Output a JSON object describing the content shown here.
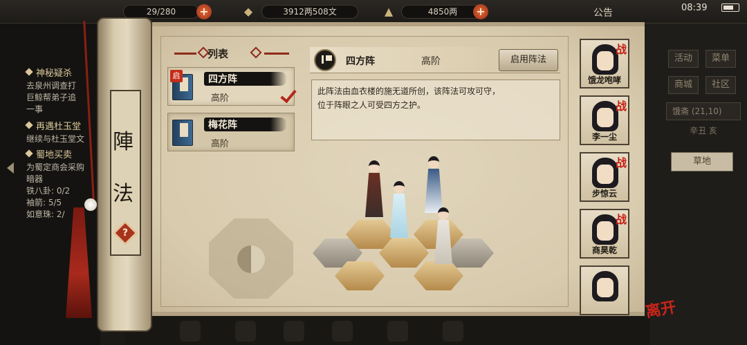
{
  "status_bar": {
    "resource1": "29/280",
    "resource2": "3912两508文",
    "resource3": "4850两",
    "announcement": "公告",
    "clock": "08:39"
  },
  "quest_panel": {
    "quests": [
      {
        "title": "神秘疑杀",
        "lines": [
          "去泉州调查打",
          "巨鲸帮弟子追",
          "一事"
        ]
      },
      {
        "title": "再遇杜玉堂",
        "lines": [
          "继续与杜玉堂文"
        ]
      },
      {
        "title": "蜀地买卖",
        "lines": [
          "为蜀定商会采购",
          "暗器",
          "铁八卦: 0/2",
          "袖箭: 5/5",
          "如意珠: 2/"
        ]
      }
    ]
  },
  "scroll": {
    "chars": [
      "陣",
      "法"
    ],
    "help": "?"
  },
  "list": {
    "title": "列表",
    "items": [
      {
        "name": "四方阵",
        "tier": "高阶",
        "tag": "启",
        "selected": true
      },
      {
        "name": "梅花阵",
        "tier": "高阶",
        "tag": "",
        "selected": false
      }
    ]
  },
  "detail": {
    "name": "四方阵",
    "tier": "高阶",
    "activate_label": "启用阵法",
    "description": [
      "此阵法由血衣楼的施无道所创，该阵法可攻可守，",
      "位于阵眼之人可受四方之护。"
    ]
  },
  "portraits": [
    {
      "name": "饿龙咆哮",
      "battle_tag": "战"
    },
    {
      "name": "李一尘",
      "battle_tag": "战"
    },
    {
      "name": "步惊云",
      "battle_tag": "战"
    },
    {
      "name": "商昊乾",
      "battle_tag": "战"
    },
    {
      "name": "",
      "battle_tag": ""
    }
  ],
  "right_panel": {
    "buttons": [
      "活动",
      "菜单",
      "商城",
      "社区"
    ],
    "location": "饿斋 (21,10)",
    "time": "辛丑 亥",
    "terrain": "草地",
    "leave": "离开"
  },
  "colors": {
    "accent_red": "#c51f14",
    "parchment": "#e6dcc4",
    "ink": "#151311"
  }
}
